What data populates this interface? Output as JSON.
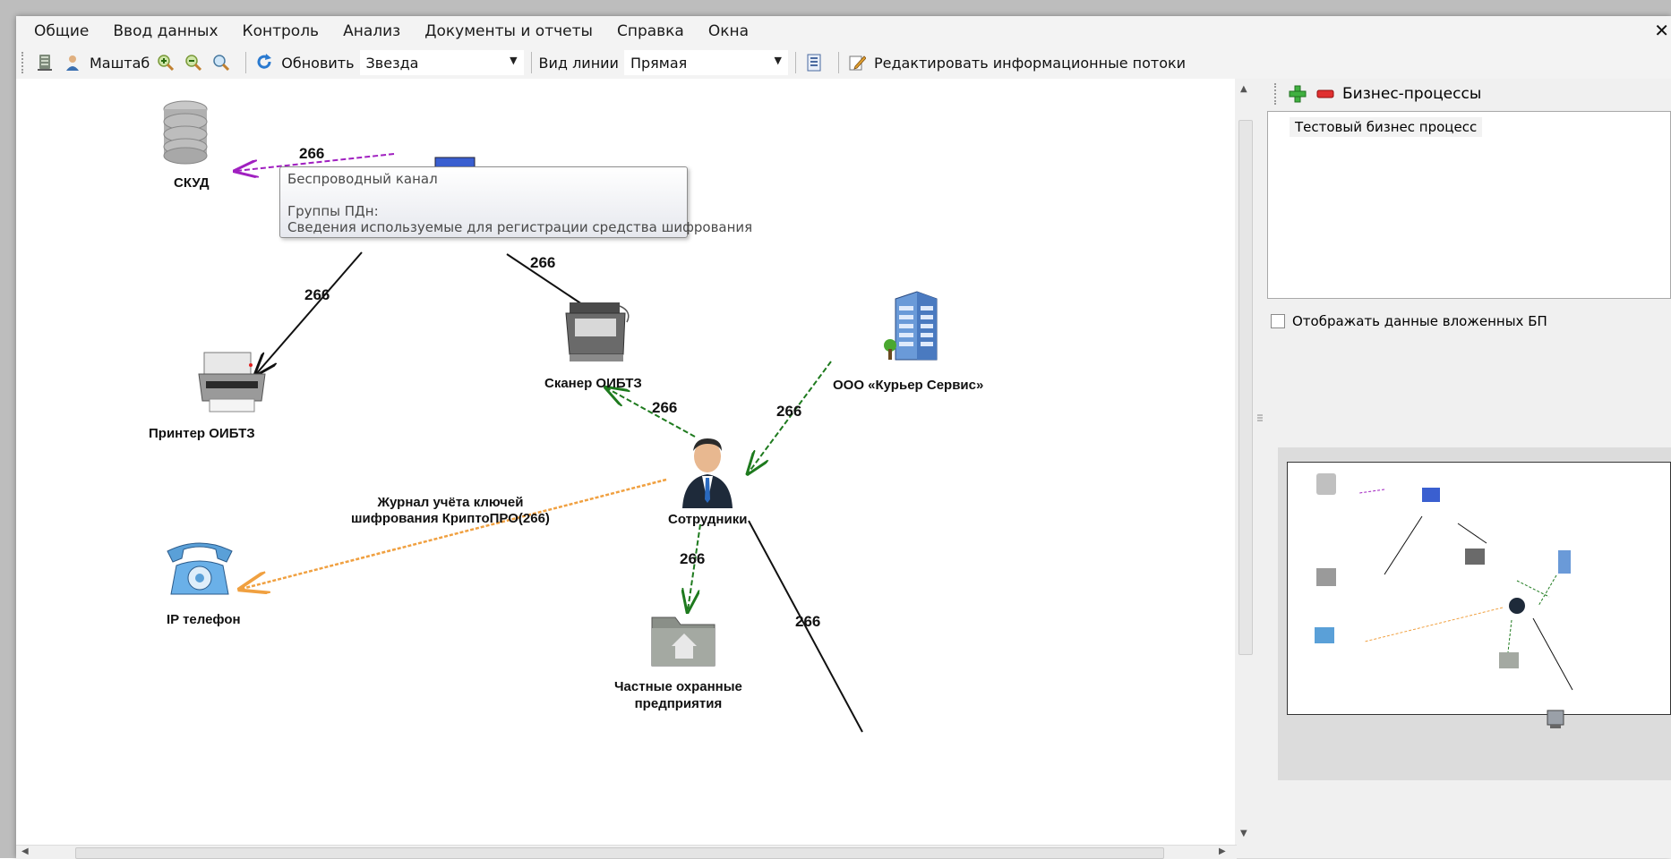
{
  "menu": [
    "Общие",
    "Ввод данных",
    "Контроль",
    "Анализ",
    "Документы и отчеты",
    "Справка",
    "Окна"
  ],
  "toolbar": {
    "scale_label": "Маштаб",
    "refresh_label": "Обновить",
    "layout_value": "Звезда",
    "line_type_label": "Вид линии",
    "line_type_value": "Прямая",
    "edit_flows_label": "Редактировать информационные потоки"
  },
  "diagram": {
    "nodes": {
      "skud": "СКУД",
      "printer": "Принтер ОИБТЗ",
      "scanner": "Сканер ОИБТЗ",
      "courier": "ООО «Курьер Сервис»",
      "employees": "Сотрудники",
      "ip_phone": "IP телефон",
      "security_line1": "Частные охранные",
      "security_line2": "предприятия"
    },
    "edge_labels": {
      "e1": "266",
      "e2": "266",
      "e3": "266",
      "e4": "266",
      "e5": "266",
      "e6": "266",
      "e7": "266",
      "journal_line1": "Журнал учёта ключей",
      "journal_line2": "шифрования КриптоПРО(266)"
    },
    "tooltip": {
      "title": "Беспроводный канал",
      "groups_label": "Группы ПДн:",
      "groups_value": "Сведения используемые для регистрации средства шифрования"
    }
  },
  "right_panel": {
    "title": "Бизнес-процессы",
    "items": [
      "Тестовый бизнес процесс"
    ],
    "show_nested_label": "Отображать данные вложенных БП"
  },
  "colors": {
    "purple_edge": "#a020c0",
    "green_edge": "#1e7a1e",
    "orange_edge": "#f0a040",
    "black_edge": "#111111"
  }
}
